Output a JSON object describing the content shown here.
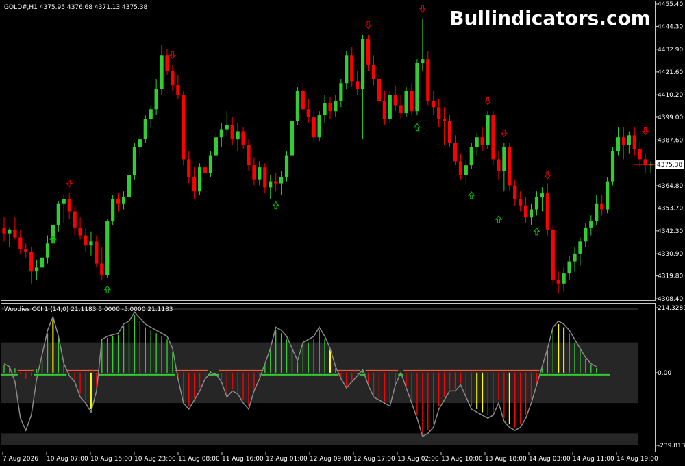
{
  "main_info": "GOLD#,H1  4375.95 4376.68 4371.13 4375.38",
  "watermark": "Bullindicators.com",
  "indicator_info": "Woodies CCI 1 (14,0) 21.1183 5.0000 -5.0000 21.1183",
  "colors": {
    "bull": "#32cd32",
    "bear": "#ff0000",
    "arrow_up": "#00b000",
    "arrow_down": "#d00000",
    "cci_line": "#8c8c8c",
    "band": "#262626",
    "zero_pos": "#32cd32",
    "zero_neg": "#ff5533",
    "neutral": "#ffff00"
  },
  "chart_data": [
    {
      "type": "candlestick",
      "name": "price",
      "ylim": [
        4308.4,
        4455.4
      ],
      "y_ticks": [
        "4455.40",
        "4444.30",
        "4432.90",
        "4421.60",
        "4410.20",
        "4399.00",
        "4387.60",
        "4376.30",
        "4364.80",
        "4353.70",
        "4342.30",
        "4330.90",
        "4319.80",
        "4308.40"
      ],
      "last_price": "4375.38",
      "candles": [
        [
          4344.0,
          4349.0,
          4337.0,
          4341.0
        ],
        [
          4341.0,
          4344.0,
          4334.0,
          4343.0
        ],
        [
          4343.0,
          4349.0,
          4338.0,
          4339.0
        ],
        [
          4339.0,
          4343.0,
          4331.0,
          4333.0
        ],
        [
          4333.0,
          4336.0,
          4329.0,
          4332.0
        ],
        [
          4332.0,
          4334.0,
          4316.0,
          4322.0
        ],
        [
          4322.0,
          4328.0,
          4318.0,
          4324.0
        ],
        [
          4324.0,
          4331.0,
          4320.0,
          4329.0
        ],
        [
          4329.0,
          4340.0,
          4326.0,
          4336.0
        ],
        [
          4336.0,
          4346.0,
          4333.0,
          4345.0
        ],
        [
          4345.0,
          4357.0,
          4342.0,
          4356.0
        ],
        [
          4356.0,
          4360.0,
          4346.0,
          4358.0
        ],
        [
          4358.0,
          4361.0,
          4348.0,
          4352.0
        ],
        [
          4352.0,
          4355.0,
          4340.0,
          4344.0
        ],
        [
          4344.0,
          4349.0,
          4338.0,
          4340.0
        ],
        [
          4340.0,
          4344.0,
          4332.0,
          4335.0
        ],
        [
          4335.0,
          4342.0,
          4330.0,
          4337.0
        ],
        [
          4337.0,
          4340.0,
          4324.0,
          4326.0
        ],
        [
          4326.0,
          4334.0,
          4318.0,
          4320.0
        ],
        [
          4320.0,
          4348.0,
          4319.0,
          4347.0
        ],
        [
          4347.0,
          4360.0,
          4345.0,
          4358.0
        ],
        [
          4358.0,
          4361.0,
          4352.0,
          4356.0
        ],
        [
          4356.0,
          4362.0,
          4353.0,
          4359.0
        ],
        [
          4359.0,
          4372.0,
          4357.0,
          4370.0
        ],
        [
          4370.0,
          4386.0,
          4368.0,
          4384.0
        ],
        [
          4384.0,
          4390.0,
          4380.0,
          4388.0
        ],
        [
          4388.0,
          4400.0,
          4386.0,
          4398.0
        ],
        [
          4398.0,
          4405.0,
          4394.0,
          4403.0
        ],
        [
          4403.0,
          4418.0,
          4400.0,
          4413.0
        ],
        [
          4413.0,
          4435.0,
          4410.0,
          4430.0
        ],
        [
          4430.0,
          4433.0,
          4420.0,
          4422.0
        ],
        [
          4422.0,
          4425.0,
          4412.0,
          4415.0
        ],
        [
          4415.0,
          4420.0,
          4408.0,
          4410.0
        ],
        [
          4410.0,
          4412.0,
          4375.0,
          4378.0
        ],
        [
          4378.0,
          4382.0,
          4366.0,
          4369.0
        ],
        [
          4369.0,
          4374.0,
          4358.0,
          4362.0
        ],
        [
          4362.0,
          4376.0,
          4360.0,
          4374.0
        ],
        [
          4374.0,
          4378.0,
          4368.0,
          4371.0
        ],
        [
          4371.0,
          4382.0,
          4369.0,
          4380.0
        ],
        [
          4380.0,
          4392.0,
          4378.0,
          4389.0
        ],
        [
          4389.0,
          4396.0,
          4384.0,
          4393.0
        ],
        [
          4393.0,
          4402.0,
          4390.0,
          4395.0
        ],
        [
          4395.0,
          4399.0,
          4385.0,
          4388.0
        ],
        [
          4388.0,
          4396.0,
          4382.0,
          4392.0
        ],
        [
          4392.0,
          4394.0,
          4383.0,
          4385.0
        ],
        [
          4385.0,
          4388.0,
          4372.0,
          4375.0
        ],
        [
          4375.0,
          4379.0,
          4365.0,
          4368.0
        ],
        [
          4368.0,
          4377.0,
          4365.0,
          4374.0
        ],
        [
          4374.0,
          4376.0,
          4361.0,
          4364.0
        ],
        [
          4364.0,
          4370.0,
          4358.0,
          4367.0
        ],
        [
          4367.0,
          4371.0,
          4362.0,
          4366.0
        ],
        [
          4366.0,
          4372.0,
          4360.0,
          4369.0
        ],
        [
          4369.0,
          4382.0,
          4367.0,
          4380.0
        ],
        [
          4380.0,
          4399.0,
          4378.0,
          4397.0
        ],
        [
          4397.0,
          4414.0,
          4395.0,
          4412.0
        ],
        [
          4412.0,
          4416.0,
          4400.0,
          4403.0
        ],
        [
          4403.0,
          4408.0,
          4396.0,
          4399.0
        ],
        [
          4399.0,
          4402.0,
          4386.0,
          4389.0
        ],
        [
          4389.0,
          4402.0,
          4387.0,
          4400.0
        ],
        [
          4400.0,
          4410.0,
          4396.0,
          4406.0
        ],
        [
          4406.0,
          4409.0,
          4398.0,
          4402.0
        ],
        [
          4402.0,
          4410.0,
          4399.0,
          4407.0
        ],
        [
          4407.0,
          4418.0,
          4404.0,
          4416.0
        ],
        [
          4416.0,
          4432.0,
          4413.0,
          4430.0
        ],
        [
          4430.0,
          4434.0,
          4414.0,
          4417.0
        ],
        [
          4417.0,
          4422.0,
          4410.0,
          4413.0
        ],
        [
          4413.0,
          4440.0,
          4388.0,
          4438.0
        ],
        [
          4438.0,
          4440.0,
          4422.0,
          4425.0
        ],
        [
          4425.0,
          4430.0,
          4415.0,
          4418.0
        ],
        [
          4418.0,
          4423.0,
          4403.0,
          4407.0
        ],
        [
          4407.0,
          4412.0,
          4395.0,
          4398.0
        ],
        [
          4398.0,
          4412.0,
          4396.0,
          4410.0
        ],
        [
          4410.0,
          4415.0,
          4402.0,
          4405.0
        ],
        [
          4405.0,
          4410.0,
          4398.0,
          4401.0
        ],
        [
          4401.0,
          4414.0,
          4399.0,
          4412.0
        ],
        [
          4412.0,
          4416.0,
          4400.0,
          4402.0
        ],
        [
          4402.0,
          4428.0,
          4400.0,
          4426.0
        ],
        [
          4426.0,
          4448.0,
          4422.0,
          4428.0
        ],
        [
          4428.0,
          4432.0,
          4405.0,
          4407.0
        ],
        [
          4407.0,
          4412.0,
          4400.0,
          4404.0
        ],
        [
          4404.0,
          4408.0,
          4394.0,
          4398.0
        ],
        [
          4398.0,
          4404.0,
          4385.0,
          4397.0
        ],
        [
          4397.0,
          4400.0,
          4384.0,
          4386.0
        ],
        [
          4386.0,
          4390.0,
          4375.0,
          4377.0
        ],
        [
          4377.0,
          4381.0,
          4368.0,
          4370.0
        ],
        [
          4370.0,
          4378.0,
          4366.0,
          4375.0
        ],
        [
          4375.0,
          4386.0,
          4373.0,
          4384.0
        ],
        [
          4384.0,
          4391.0,
          4380.0,
          4389.0
        ],
        [
          4389.0,
          4394.0,
          4382.0,
          4385.0
        ],
        [
          4385.0,
          4402.0,
          4383.0,
          4400.0
        ],
        [
          4400.0,
          4402.0,
          4375.0,
          4378.0
        ],
        [
          4378.0,
          4382.0,
          4368.0,
          4372.0
        ],
        [
          4372.0,
          4386.0,
          4362.0,
          4384.0
        ],
        [
          4384.0,
          4386.0,
          4362.0,
          4365.0
        ],
        [
          4365.0,
          4368.0,
          4355.0,
          4358.0
        ],
        [
          4358.0,
          4362.0,
          4352.0,
          4355.0
        ],
        [
          4355.0,
          4359.0,
          4346.0,
          4349.0
        ],
        [
          4349.0,
          4356.0,
          4345.0,
          4353.0
        ],
        [
          4353.0,
          4362.0,
          4350.0,
          4359.0
        ],
        [
          4359.0,
          4364.0,
          4352.0,
          4361.0
        ],
        [
          4361.0,
          4366.0,
          4340.0,
          4343.0
        ],
        [
          4343.0,
          4345.0,
          4315.0,
          4318.0
        ],
        [
          4318.0,
          4322.0,
          4311.0,
          4316.0
        ],
        [
          4316.0,
          4324.0,
          4312.0,
          4321.0
        ],
        [
          4321.0,
          4330.0,
          4318.0,
          4327.0
        ],
        [
          4327.0,
          4334.0,
          4322.0,
          4331.0
        ],
        [
          4331.0,
          4339.0,
          4325.0,
          4337.0
        ],
        [
          4337.0,
          4346.0,
          4334.0,
          4344.0
        ],
        [
          4344.0,
          4350.0,
          4340.0,
          4347.0
        ],
        [
          4347.0,
          4360.0,
          4345.0,
          4356.0
        ],
        [
          4356.0,
          4360.0,
          4350.0,
          4353.0
        ],
        [
          4353.0,
          4369.0,
          4351.0,
          4367.0
        ],
        [
          4367.0,
          4384.0,
          4365.0,
          4382.0
        ],
        [
          4382.0,
          4394.0,
          4380.0,
          4389.0
        ],
        [
          4389.0,
          4394.0,
          4378.0,
          4385.0
        ],
        [
          4385.0,
          4392.0,
          4381.0,
          4390.0
        ],
        [
          4390.0,
          4394.0,
          4380.0,
          4383.0
        ],
        [
          4383.0,
          4387.0,
          4374.0,
          4378.0
        ],
        [
          4378.0,
          4381.0,
          4371.0,
          4375.0
        ],
        [
          4375.0,
          4377.0,
          4371.0,
          4375.4
        ]
      ],
      "signals": [
        {
          "bar": 9,
          "dir": "up",
          "price": 4338.0
        },
        {
          "bar": 12,
          "dir": "down",
          "price": 4366.0
        },
        {
          "bar": 19,
          "dir": "up",
          "price": 4313.0
        },
        {
          "bar": 31,
          "dir": "down",
          "price": 4430.0
        },
        {
          "bar": 50,
          "dir": "up",
          "price": 4355.0
        },
        {
          "bar": 67,
          "dir": "down",
          "price": 4445.0
        },
        {
          "bar": 77,
          "dir": "down",
          "price": 4453.0
        },
        {
          "bar": 76,
          "dir": "up",
          "price": 4394.0
        },
        {
          "bar": 86,
          "dir": "up",
          "price": 4360.0
        },
        {
          "bar": 89,
          "dir": "down",
          "price": 4407.0
        },
        {
          "bar": 91,
          "dir": "up",
          "price": 4348.0
        },
        {
          "bar": 92,
          "dir": "down",
          "price": 4391.0
        },
        {
          "bar": 98,
          "dir": "up",
          "price": 4342.0
        },
        {
          "bar": 100,
          "dir": "down",
          "price": 4370.0
        },
        {
          "bar": 118,
          "dir": "down",
          "price": 4392.0
        }
      ]
    },
    {
      "type": "bar",
      "name": "cci",
      "ylim": [
        -239.8139,
        214.3289
      ],
      "y_ticks": [
        "214.3289",
        "0.00",
        "-239.8139"
      ],
      "levels": [
        100,
        -100,
        -200
      ],
      "line": [
        30,
        20,
        -30,
        -150,
        -190,
        -140,
        -20,
        60,
        140,
        185,
        120,
        30,
        -10,
        -30,
        -80,
        -100,
        -130,
        -60,
        110,
        120,
        125,
        130,
        160,
        170,
        200,
        180,
        160,
        150,
        140,
        130,
        120,
        80,
        -20,
        -100,
        -120,
        -90,
        -60,
        -20,
        0,
        -5,
        -30,
        -80,
        -60,
        -70,
        -100,
        -120,
        -60,
        -20,
        30,
        80,
        150,
        140,
        120,
        80,
        40,
        100,
        110,
        120,
        150,
        120,
        80,
        20,
        -20,
        -50,
        -30,
        -10,
        10,
        -40,
        -80,
        -90,
        -100,
        -110,
        -40,
        0,
        -50,
        -100,
        -150,
        -210,
        -200,
        -180,
        -120,
        -90,
        -60,
        -60,
        -40,
        -80,
        -120,
        -130,
        -140,
        -150,
        -140,
        -100,
        -160,
        -180,
        -190,
        -180,
        -150,
        -100,
        -40,
        20,
        80,
        150,
        170,
        160,
        140,
        110,
        80,
        50,
        30,
        20
      ],
      "histogram": [
        25,
        18,
        15,
        -5,
        -20,
        -10,
        12,
        40,
        130,
        175,
        110,
        25,
        -5,
        -25,
        -70,
        -90,
        -120,
        -50,
        100,
        115,
        120,
        125,
        155,
        165,
        190,
        170,
        150,
        140,
        130,
        120,
        110,
        70,
        -15,
        -90,
        -110,
        -85,
        -50,
        -15,
        5,
        -5,
        -25,
        -70,
        -55,
        -65,
        -90,
        -110,
        -55,
        -15,
        25,
        75,
        140,
        130,
        110,
        75,
        35,
        90,
        100,
        110,
        140,
        110,
        75,
        15,
        -15,
        -45,
        -25,
        -5,
        10,
        -35,
        -75,
        -85,
        -95,
        -100,
        -35,
        -5,
        -45,
        -90,
        -140,
        -200,
        -190,
        -170,
        -110,
        -80,
        -55,
        -55,
        -35,
        -75,
        -110,
        -120,
        -130,
        -140,
        -130,
        -90,
        -150,
        -170,
        -180,
        -170,
        -140,
        -90,
        -35,
        15,
        75,
        140,
        160,
        150,
        130,
        100,
        75,
        45,
        25,
        15
      ],
      "neutral_bars": [
        9,
        16,
        60,
        87,
        88,
        93,
        102,
        103
      ],
      "zero_sign": [
        1,
        1,
        1,
        -1,
        -1,
        -1,
        1,
        1,
        1,
        1,
        1,
        1,
        -1,
        -1,
        -1,
        -1,
        -1,
        -1,
        1,
        1,
        1,
        1,
        1,
        1,
        1,
        1,
        1,
        1,
        1,
        1,
        1,
        1,
        -1,
        -1,
        -1,
        -1,
        -1,
        -1,
        1,
        1,
        -1,
        -1,
        -1,
        -1,
        -1,
        -1,
        -1,
        -1,
        1,
        1,
        1,
        1,
        1,
        1,
        1,
        1,
        1,
        1,
        1,
        1,
        1,
        1,
        -1,
        -1,
        -1,
        -1,
        1,
        -1,
        -1,
        -1,
        -1,
        -1,
        -1,
        1,
        -1,
        -1,
        -1,
        -1,
        -1,
        -1,
        -1,
        -1,
        -1,
        -1,
        -1,
        -1,
        -1,
        -1,
        -1,
        -1,
        -1,
        -1,
        -1,
        -1,
        -1,
        -1,
        -1,
        -1,
        -1,
        1,
        1,
        1,
        1,
        1,
        1,
        1,
        1,
        1,
        1,
        1,
        1,
        1
      ]
    }
  ],
  "x_ticks": [
    "7 Aug 2026",
    "10 Aug 07:00",
    "10 Aug 15:00",
    "10 Aug 23:00",
    "11 Aug 08:00",
    "11 Aug 16:00",
    "12 Aug 01:00",
    "12 Aug 09:00",
    "12 Aug 17:00",
    "13 Aug 02:00",
    "13 Aug 10:00",
    "13 Aug 18:00",
    "14 Aug 03:00",
    "14 Aug 11:00",
    "14 Aug 19:00"
  ]
}
